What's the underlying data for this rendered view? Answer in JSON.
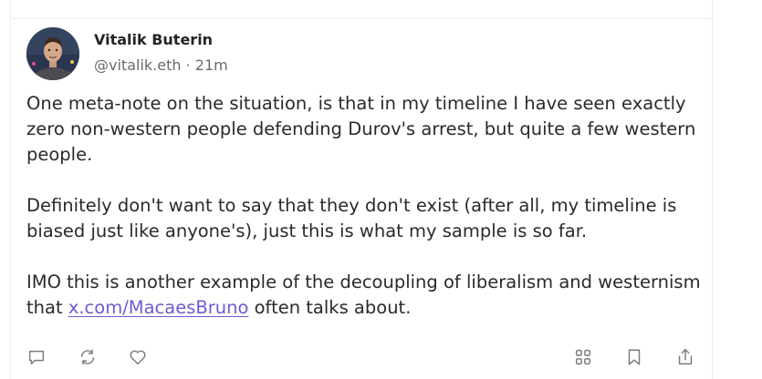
{
  "post": {
    "author_name": "Vitalik Buterin",
    "author_handle": "@vitalik.eth",
    "separator": " · ",
    "time_ago": "21m",
    "paragraph1": "One meta-note on the situation, is that in my timeline I have seen exactly zero non-western people defending Durov's arrest, but quite a few western people.",
    "paragraph2": "Definitely don't want to say that they don't exist (after all, my timeline is biased just like anyone's), just this is what my sample is so far.",
    "paragraph3_before": "IMO this is another example of the decoupling of liberalism and westernism that ",
    "paragraph3_link": "x.com/MacaesBruno",
    "paragraph3_after": " often talks about."
  },
  "actions": {
    "reply_icon": "comment-icon",
    "repost_icon": "repost-icon",
    "like_icon": "heart-icon",
    "grid_icon": "grid-icon",
    "bookmark_icon": "bookmark-icon",
    "share_icon": "share-icon"
  },
  "colors": {
    "link": "#6d5bd0",
    "text": "#2a2a2a",
    "muted": "#6a6a6a",
    "icon": "#7b7b7b"
  }
}
